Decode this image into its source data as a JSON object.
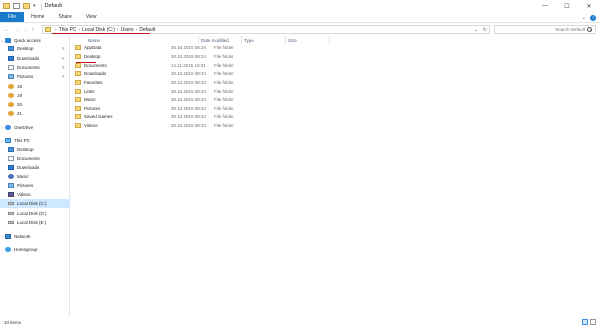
{
  "window": {
    "title": "Default",
    "controls": {
      "minimize": "—",
      "maximize": "☐",
      "close": "✕"
    }
  },
  "ribbon": {
    "tabs": [
      "File",
      "Home",
      "Share",
      "View"
    ]
  },
  "address": {
    "crumbs": [
      "This PC",
      "Local Disk (C:)",
      "Users",
      "Default"
    ],
    "search_placeholder": "Search Default"
  },
  "nav_pane": {
    "items": [
      {
        "label": "Quick access",
        "icon": "star-icon",
        "indent": 0,
        "pinned": false
      },
      {
        "label": "Desktop",
        "icon": "desktop-icon",
        "indent": 1,
        "pinned": true
      },
      {
        "label": "Downloads",
        "icon": "downloads-icon",
        "indent": 1,
        "pinned": true
      },
      {
        "label": "Documents",
        "icon": "documents-icon",
        "indent": 1,
        "pinned": true
      },
      {
        "label": "Pictures",
        "icon": "pictures-icon",
        "indent": 1,
        "pinned": true
      },
      {
        "label": "18",
        "icon": "folder-icon",
        "indent": 1,
        "pinned": false
      },
      {
        "label": "19",
        "icon": "folder-icon",
        "indent": 1,
        "pinned": false
      },
      {
        "label": "20",
        "icon": "folder-icon",
        "indent": 1,
        "pinned": false
      },
      {
        "label": "21",
        "icon": "folder-icon",
        "indent": 1,
        "pinned": false
      },
      {
        "label": "OneDrive",
        "icon": "onedrive-icon",
        "indent": 0,
        "pinned": false
      },
      {
        "label": "This PC",
        "icon": "this-pc-icon",
        "indent": 0,
        "pinned": false
      },
      {
        "label": "Desktop",
        "icon": "desktop-icon",
        "indent": 1,
        "pinned": false
      },
      {
        "label": "Documents",
        "icon": "documents-icon",
        "indent": 1,
        "pinned": false
      },
      {
        "label": "Downloads",
        "icon": "downloads-icon",
        "indent": 1,
        "pinned": false
      },
      {
        "label": "Music",
        "icon": "music-icon",
        "indent": 1,
        "pinned": false
      },
      {
        "label": "Pictures",
        "icon": "pictures-icon",
        "indent": 1,
        "pinned": false
      },
      {
        "label": "Videos",
        "icon": "videos-icon",
        "indent": 1,
        "pinned": false
      },
      {
        "label": "Local Disk (C:)",
        "icon": "drive-icon",
        "indent": 1,
        "pinned": false,
        "selected": true
      },
      {
        "label": "Local Disk (D:)",
        "icon": "drive-icon",
        "indent": 1,
        "pinned": false
      },
      {
        "label": "Local Disk (E:)",
        "icon": "drive-icon",
        "indent": 1,
        "pinned": false
      },
      {
        "label": "Network",
        "icon": "network-icon",
        "indent": 0,
        "pinned": false
      },
      {
        "label": "Homegroup",
        "icon": "homegroup-icon",
        "indent": 0,
        "pinned": false
      }
    ]
  },
  "columns": {
    "name": "Name",
    "date": "Date modified",
    "type": "Type",
    "size": "Size"
  },
  "files": [
    {
      "name": "AppData",
      "date": "30.10.2015 08:24",
      "type": "File folder"
    },
    {
      "name": "Desktop",
      "date": "30.10.2015 08:24",
      "type": "File folder"
    },
    {
      "name": "Documents",
      "date": "12.11.2015 19:31",
      "type": "File folder"
    },
    {
      "name": "Downloads",
      "date": "30.10.2015 08:24",
      "type": "File folder"
    },
    {
      "name": "Favorites",
      "date": "30.10.2015 08:24",
      "type": "File folder"
    },
    {
      "name": "Links",
      "date": "30.10.2015 08:24",
      "type": "File folder"
    },
    {
      "name": "Music",
      "date": "30.10.2015 08:24",
      "type": "File folder"
    },
    {
      "name": "Pictures",
      "date": "30.10.2015 08:24",
      "type": "File folder"
    },
    {
      "name": "Saved Games",
      "date": "30.10.2015 08:24",
      "type": "File folder"
    },
    {
      "name": "Videos",
      "date": "30.10.2015 08:24",
      "type": "File folder"
    }
  ],
  "status": {
    "count": "10 items"
  },
  "colors": {
    "accent": "#1979ca",
    "selection": "#cde8ff",
    "annotation": "#c41818",
    "folder": "#f7d775"
  }
}
